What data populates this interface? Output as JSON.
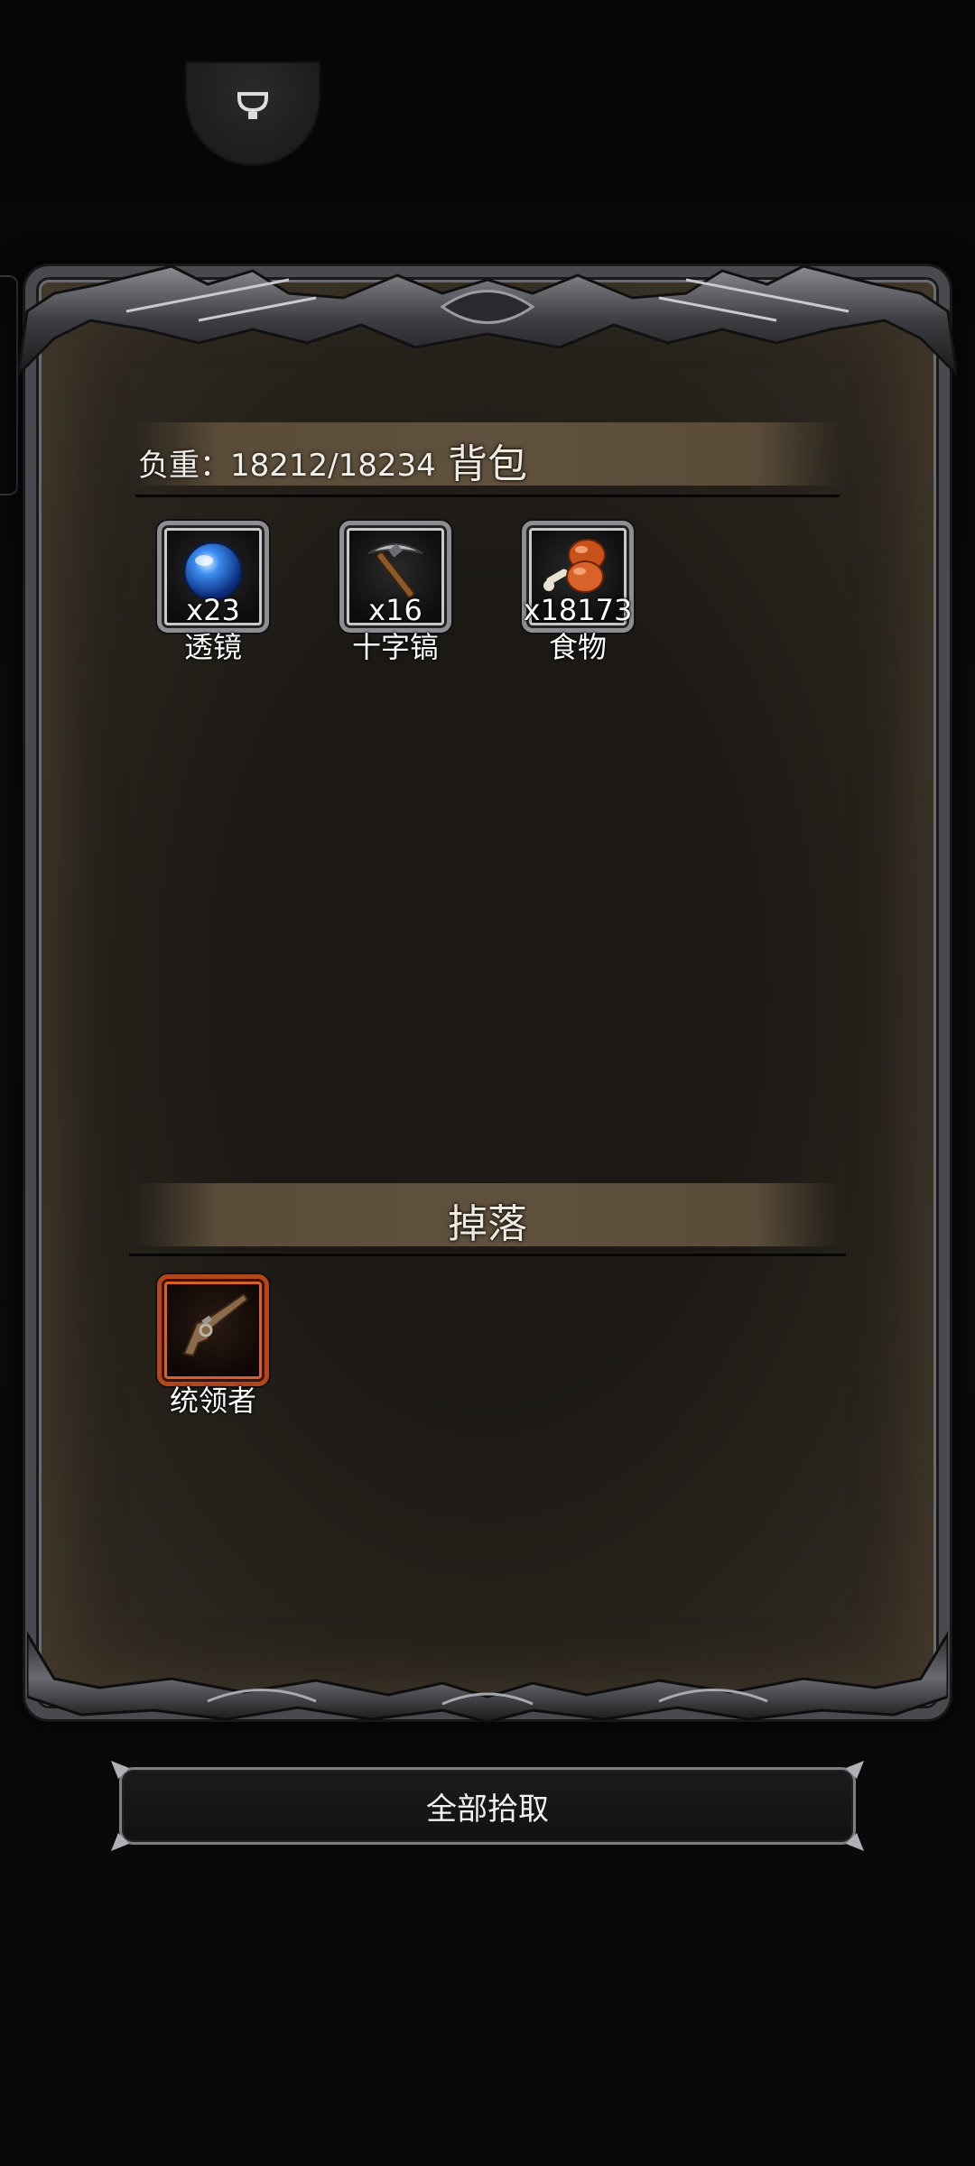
{
  "top_button": {
    "icon": "lightbulb-icon"
  },
  "backpack": {
    "weight_label": "负重：18212/18234",
    "title": "背包",
    "items": [
      {
        "name": "透镜",
        "count": "x23",
        "icon": "lens-orb-icon",
        "frame_color": "#8d8d92"
      },
      {
        "name": "十字镐",
        "count": "x16",
        "icon": "pickaxe-icon",
        "frame_color": "#8d8d92"
      },
      {
        "name": "食物",
        "count": "x18173",
        "icon": "meat-icon",
        "frame_color": "#8d8d92"
      }
    ]
  },
  "drops": {
    "title": "掉落",
    "items": [
      {
        "name": "统领者",
        "icon": "flintlock-pistol-icon",
        "frame_color": "#b4461e"
      }
    ]
  },
  "pickup_all_label": "全部拾取",
  "colors": {
    "panel_bg": "#1c1915",
    "header_bar": "#5f513d",
    "frame_metal": "#4a4a4e",
    "rare_frame": "#b4461e"
  }
}
